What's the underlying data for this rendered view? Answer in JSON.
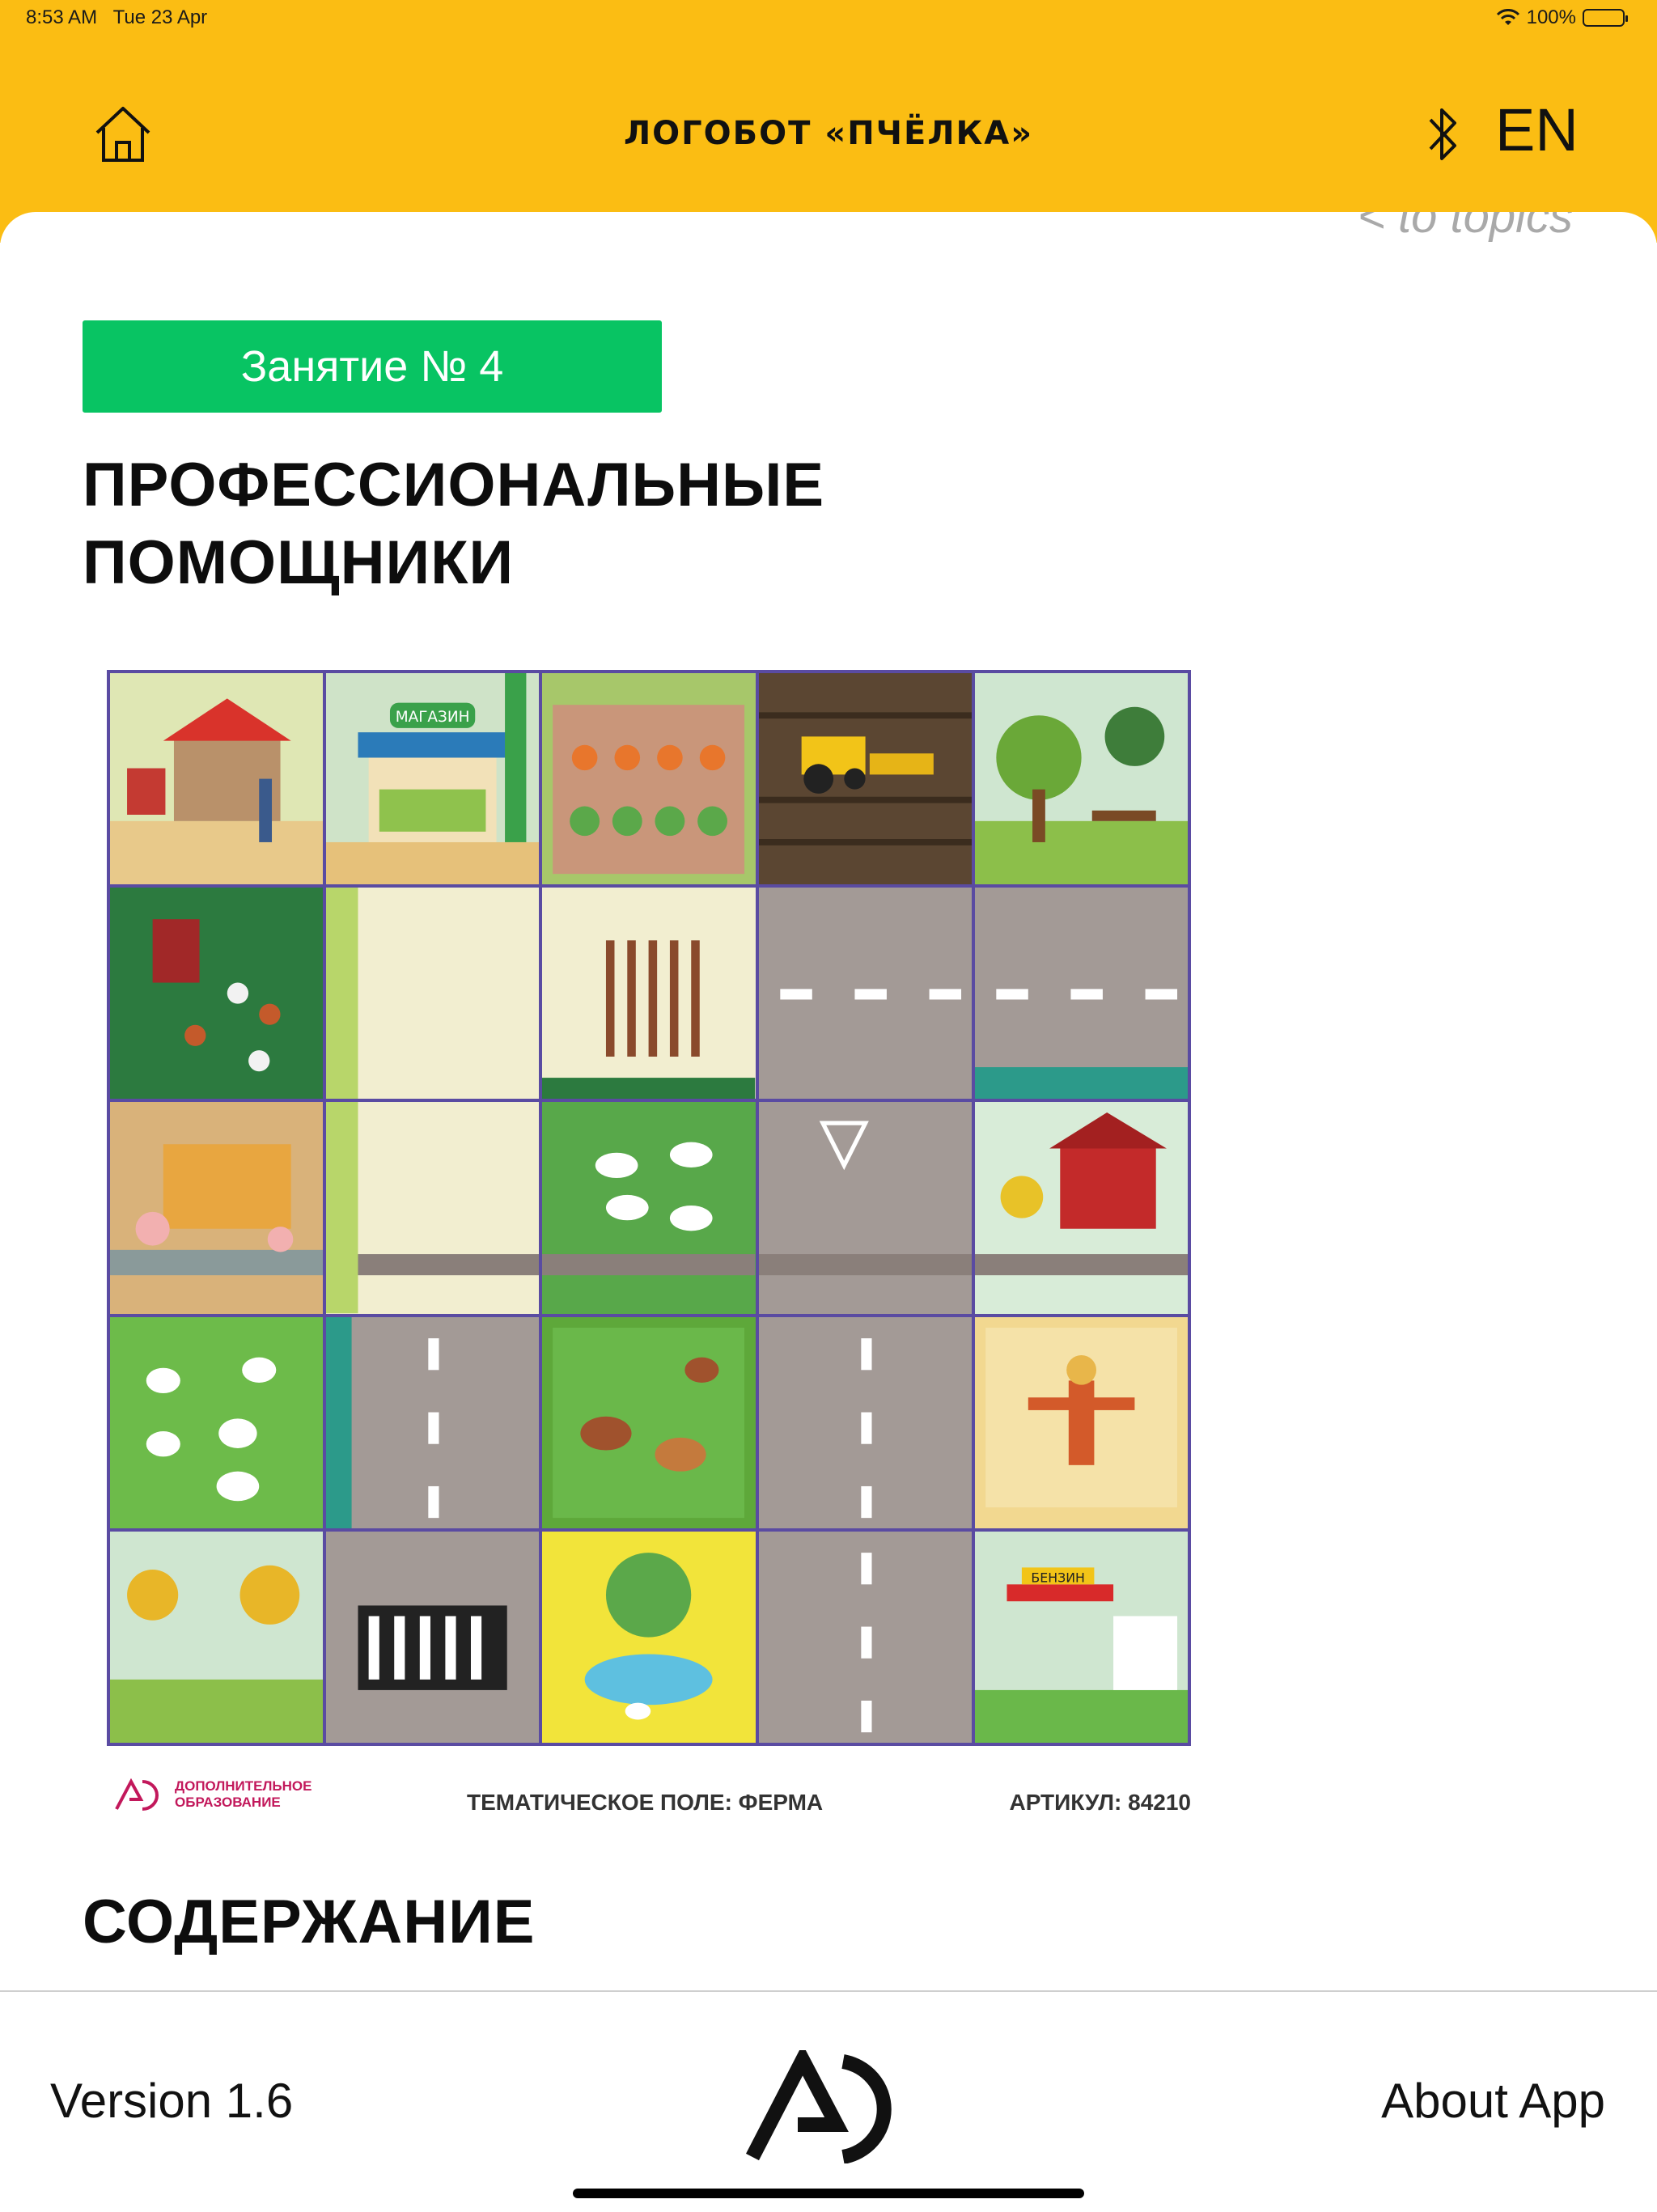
{
  "status_bar": {
    "time": "8:53 AM",
    "date": "Tue 23 Apr",
    "battery": "100%"
  },
  "header": {
    "title": "ЛОГОБОТ «ПЧЁЛКА»",
    "language": "EN",
    "icons": [
      "home-icon",
      "bluetooth-icon"
    ],
    "color": "#fbbd13"
  },
  "nav": {
    "back_label": "< to topics"
  },
  "lesson": {
    "badge": "Занятие № 4",
    "badge_color": "#08c463",
    "title_line1": "ПРОФЕССИОНАЛЬНЫЕ",
    "title_line2": "ПОМОЩНИКИ"
  },
  "poster": {
    "theme": "ТЕМАТИЧЕСКОЕ ПОЛЕ: ФЕРМА",
    "article": "АРТИКУЛ: 84210",
    "publisher": "ДОПОЛНИТЕЛЬНОЕ ОБРАЗОВАНИЕ",
    "shop_sign": "МАГАЗИН",
    "gas_sign": "БЕНЗИН"
  },
  "contents": {
    "heading": "СОДЕРЖАНИЕ"
  },
  "footer": {
    "version": "Version 1.6",
    "about": "About App"
  }
}
